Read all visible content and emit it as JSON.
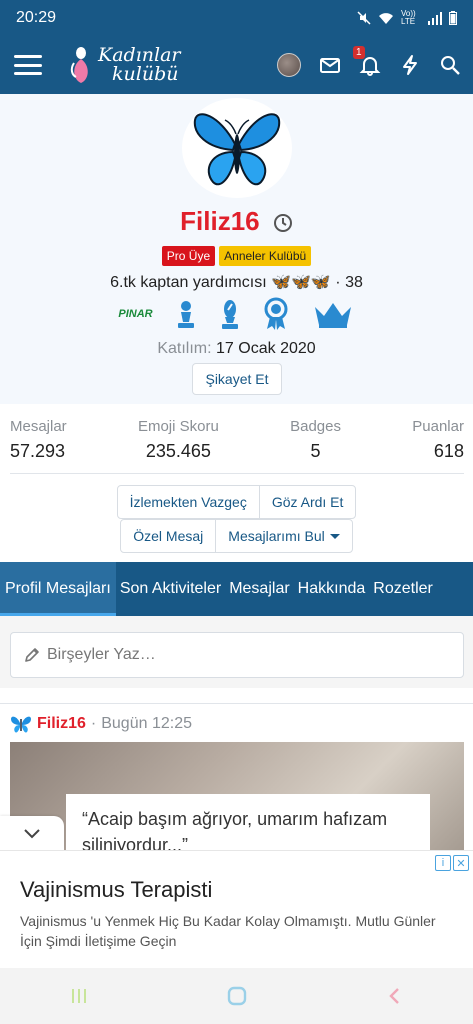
{
  "status_bar": {
    "time": "20:29",
    "icons": [
      "mute-icon",
      "wifi-icon",
      "volte-icon",
      "signal-icon",
      "battery-icon"
    ],
    "volte_text": "Vo)) LTE"
  },
  "header": {
    "logo_line1": "Kadınlar",
    "logo_line2": "kulübü",
    "notification_count": "1",
    "colors": {
      "bar": "#185886"
    }
  },
  "profile": {
    "username": "Filiz16",
    "tags": [
      "Pro Üye",
      "Anneler Kulübü"
    ],
    "user_title": "6.tk kaptan yardımcısı 🦋🦋🦋 · 38",
    "awards": [
      "pinar-icon",
      "pawn-icon",
      "bishop-icon",
      "ribbon-icon",
      "crown-icon"
    ],
    "pinar_text": "PINAR",
    "joined_label": "Katılım:",
    "joined_date": "17 Ocak 2020",
    "report_label": "Şikayet Et",
    "colors": {
      "name": "#e0202b",
      "tag_pro": "#d8141c",
      "tag_mom": "#f5c200"
    }
  },
  "stats": [
    {
      "label": "Mesajlar",
      "value": "57.293"
    },
    {
      "label": "Emoji Skoru",
      "value": "235.465"
    },
    {
      "label": "Badges",
      "value": "5"
    },
    {
      "label": "Puanlar",
      "value": "618"
    }
  ],
  "actions": {
    "unwatch": "İzlemekten Vazgeç",
    "ignore": "Göz Ardı Et",
    "pm": "Özel Mesaj",
    "find_posts": "Mesajlarımı Bul"
  },
  "tabs": [
    "Profil Mesajları",
    "Son Aktiviteler",
    "Mesajlar",
    "Hakkında",
    "Rozetler"
  ],
  "composer": {
    "placeholder": "Birşeyler Yaz…"
  },
  "post": {
    "author": "Filiz16",
    "separator": "·",
    "time": "Bugün 12:25",
    "quote_line1": "“Acaip başım ağrıyor, umarım hafızam",
    "quote_line2": "siliniyordur...”"
  },
  "ad": {
    "title": "Vajinismus Terapisti",
    "description": "Vajinismus 'u Yenmek Hiç Bu Kadar Kolay Olmamıştı. Mutlu Günler İçin Şimdi İletişime Geçin"
  },
  "nav": [
    "recents-icon",
    "home-icon",
    "back-icon"
  ]
}
